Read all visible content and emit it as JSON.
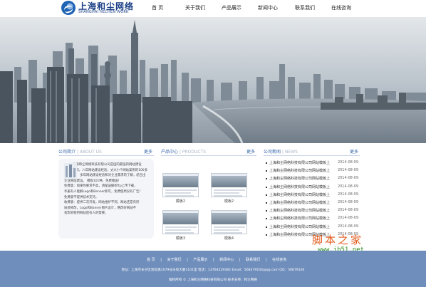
{
  "header": {
    "logo_cn": "上海和尘网络",
    "logo_en": "SHANGHAI HECHEN WORK",
    "nav": [
      "首 页",
      "关于我们",
      "产品展示",
      "新闻中心",
      "联系我们",
      "在线咨询"
    ]
  },
  "banner": {
    "slides": 2,
    "active_slide": 2
  },
  "about": {
    "title": "公司简介",
    "title_en": "| ABOUT US",
    "more": "更多",
    "lines": [
      "上海和尘网络科技有限公司是国内最强的网站建设",
      "公司，八年网站建设经验，丈大小个网站案例的100多",
      "个。 多年网站建设经验和对企业需求的了解，结合出",
      "企业网站建设。 模板101种，免费赠送！",
      "免费版：如果你要求不高，请赋送解析ftp上传下载，",
      "手册有人能解Logo和Banner即可，免费使用没有广告！",
      "免费版不提供技术支持。",
      "收费版：提供二次开发，网站维护不到，网站还是有所",
      "局部修改，Logo和Banner图片设计，略改好网站不",
      "会影响使用网站后有人的需要。"
    ]
  },
  "products": {
    "title": "产品中心",
    "title_en": "| PRODUCTS",
    "more": "更多",
    "items": [
      "模板2",
      "模板2",
      "模板3",
      "模板4"
    ]
  },
  "news": {
    "title": "公司新闻",
    "title_en": "| NEWS",
    "more": "更多",
    "items": [
      {
        "title": "上海和尘网络科技有限公司网站模板上",
        "date": "2014-08-09"
      },
      {
        "title": "上海和尘网络科技有限公司网站模板上",
        "date": "2014-08-09"
      },
      {
        "title": "上海和尘网络科技有限公司网站模板上",
        "date": "2014-08-09"
      },
      {
        "title": "上海和尘网络科技有限公司网站模板上",
        "date": "2014-08-09"
      },
      {
        "title": "上海和尘网络科技有限公司网站模板上",
        "date": "2014-08-09"
      },
      {
        "title": "上海和尘网络科技有限公司网站模板上",
        "date": "2014-08-09"
      },
      {
        "title": "上海和尘网络科技有限公司网站模板上",
        "date": "2014-08-09"
      },
      {
        "title": "上海和尘网络科技有限公司网站模板上",
        "date": "2014-08-09"
      },
      {
        "title": "上海和尘网络科技有限公司网站模板上",
        "date": "2014-08-09"
      },
      {
        "title": "上海和尘网络科技有限公司网站模板上",
        "date": "2014-08-09"
      }
    ]
  },
  "footer": {
    "nav": [
      "首 页",
      "|",
      "关于我们",
      "|",
      "产品展示",
      "|",
      "新闻中心",
      "|",
      "联系我们",
      "|",
      "在线咨询"
    ],
    "address": "地址：上海市长宁区淞虹路1079号乐尚大厦1101室  电话：13764229382  Email：568379104@qq.com  QQ：56879104",
    "copyright": "版权所有 © 上海和尘网络科技有限公司  技术支持：和尘网络"
  },
  "watermark": {
    "cn": "脚本之家",
    "url": "www.jb51.net"
  },
  "colors": {
    "accent": "#3264a8",
    "footer_bg": "#6f8ebc",
    "watermark_cn": "#e25b1c",
    "watermark_url": "#2d8c1c"
  }
}
